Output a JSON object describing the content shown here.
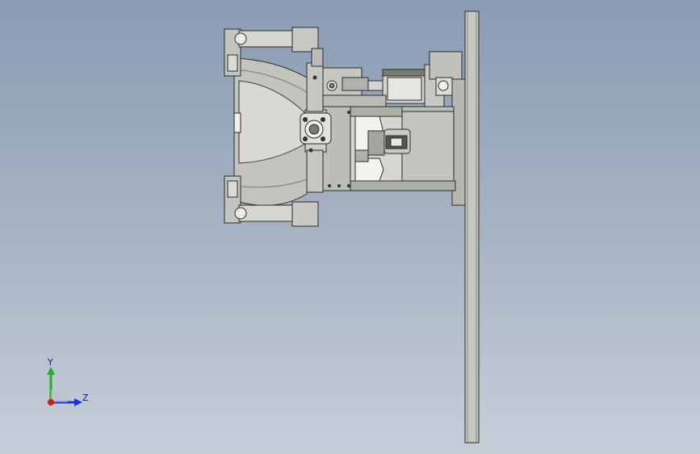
{
  "viewport": {
    "background_top": "#8a9cb4",
    "background_bottom": "#c7ced8"
  },
  "model": {
    "edge_color": "#2a2a2a",
    "body_color": "#bcbcb6",
    "light_color": "#d9d9d4",
    "dark_color": "#6f6f6a",
    "accent_color": "#f2f2ee"
  },
  "triad": {
    "y_label": "Y",
    "z_label": "Z",
    "y_color": "#1fae2a",
    "z_color": "#2233d6",
    "x_color": "#d21b1b"
  }
}
